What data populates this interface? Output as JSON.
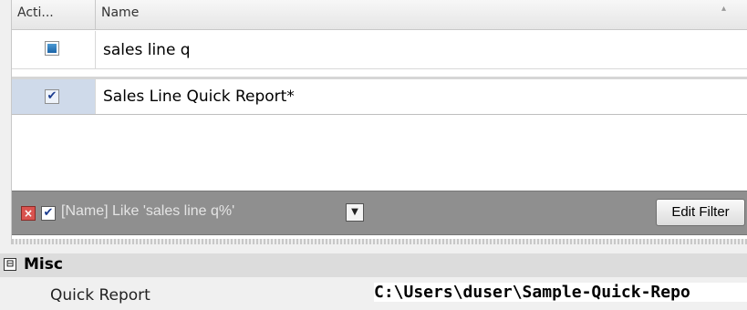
{
  "grid": {
    "columns": [
      {
        "id": "active",
        "label": "Acti..."
      },
      {
        "id": "name",
        "label": "Name"
      }
    ],
    "rows": [
      {
        "active_state": "indeterminate",
        "name": "sales line q"
      },
      {
        "active_state": "checked",
        "name": "Sales Line Quick Report*",
        "selected": true
      }
    ]
  },
  "filter_bar": {
    "enabled": true,
    "expression": "[Name] Like 'sales line q%'",
    "edit_button_label": "Edit Filter"
  },
  "properties": {
    "category_expander": "⊟",
    "category": "Misc",
    "items": [
      {
        "name": "Quick Report",
        "value": "C:\\Users\\duser\\Sample-Quick-Repo"
      }
    ]
  },
  "colors": {
    "filter_bar_bg": "#8f8f8f",
    "selected_cell_bg": "#cfdaea",
    "clear_filter_icon": "#d9534f"
  }
}
